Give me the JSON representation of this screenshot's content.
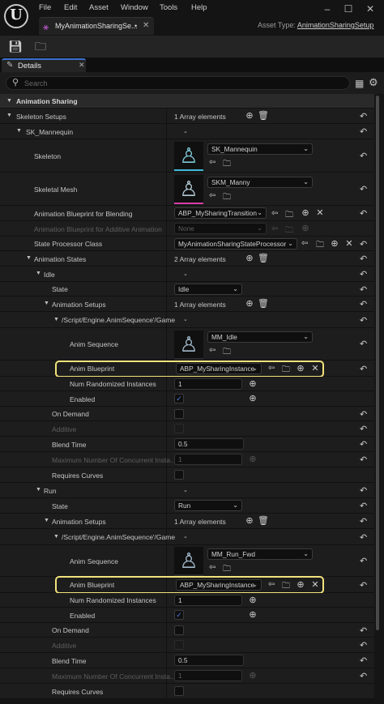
{
  "menu": [
    "File",
    "Edit",
    "Asset",
    "Window",
    "Tools",
    "Help"
  ],
  "logo": "U",
  "document_tab": {
    "title": "MyAnimationSharingSe...",
    "modified": "•"
  },
  "asset_type": {
    "label": "Asset Type:",
    "value": "AnimationSharingSetup"
  },
  "details_tab": {
    "label": "Details"
  },
  "search": {
    "placeholder": "Search"
  },
  "properties": {
    "animation_sharing": "Animation Sharing",
    "skeleton_setups": {
      "label": "Skeleton Setups",
      "count": "1 Array elements"
    },
    "sk_mannequin": {
      "label": "SK_Mannequin"
    },
    "skeleton": {
      "label": "Skeleton",
      "value": "SK_Mannequin"
    },
    "skeletal_mesh": {
      "label": "Skeletal Mesh",
      "value": "SKM_Manny"
    },
    "blend_bp": {
      "label": "Animation Blueprint for Blending",
      "value": "ABP_MySharingTransition"
    },
    "additive_bp": {
      "label": "Animation Blueprint for Additive Animation",
      "value": "None"
    },
    "state_processor": {
      "label": "State Processor Class",
      "value": "MyAnimationSharingStateProcessor"
    },
    "animation_states": {
      "label": "Animation States",
      "count": "2 Array elements"
    },
    "idle": {
      "label": "Idle",
      "state": {
        "label": "State",
        "value": "Idle"
      },
      "setups": {
        "label": "Animation Setups",
        "count": "1 Array elements"
      },
      "path": "/Script/Engine.AnimSequence'/Game",
      "anim_sequence": {
        "label": "Anim Sequence",
        "value": "MM_Idle"
      },
      "anim_blueprint": {
        "label": "Anim Blueprint",
        "value": "ABP_MySharingInstance"
      },
      "num_random": {
        "label": "Num Randomized Instances",
        "value": "1"
      },
      "enabled": {
        "label": "Enabled"
      },
      "on_demand": {
        "label": "On Demand"
      },
      "additive": {
        "label": "Additive"
      },
      "blend_time": {
        "label": "Blend Time",
        "value": "0.5"
      },
      "max_concurrent": {
        "label": "Maximum Number Of Concurrent Insta...",
        "value": "1"
      },
      "requires_curves": {
        "label": "Requires Curves"
      }
    },
    "run": {
      "label": "Run",
      "state": {
        "label": "State",
        "value": "Run"
      },
      "setups": {
        "label": "Animation Setups",
        "count": "1 Array elements"
      },
      "path": "/Script/Engine.AnimSequence'/Game",
      "anim_sequence": {
        "label": "Anim Sequence",
        "value": "MM_Run_Fwd"
      },
      "anim_blueprint": {
        "label": "Anim Blueprint",
        "value": "ABP_MySharingInstance"
      },
      "num_random": {
        "label": "Num Randomized Instances",
        "value": "1"
      },
      "enabled": {
        "label": "Enabled"
      },
      "on_demand": {
        "label": "On Demand"
      },
      "additive": {
        "label": "Additive"
      },
      "blend_time": {
        "label": "Blend Time",
        "value": "0.5"
      },
      "max_concurrent": {
        "label": "Maximum Number Of Concurrent Insta...",
        "value": "1"
      },
      "requires_curves": {
        "label": "Requires Curves"
      }
    }
  },
  "colors": {
    "highlight": "#f2e27b",
    "accent": "#3a6fd0",
    "checkmark": "#4a7fe0"
  }
}
